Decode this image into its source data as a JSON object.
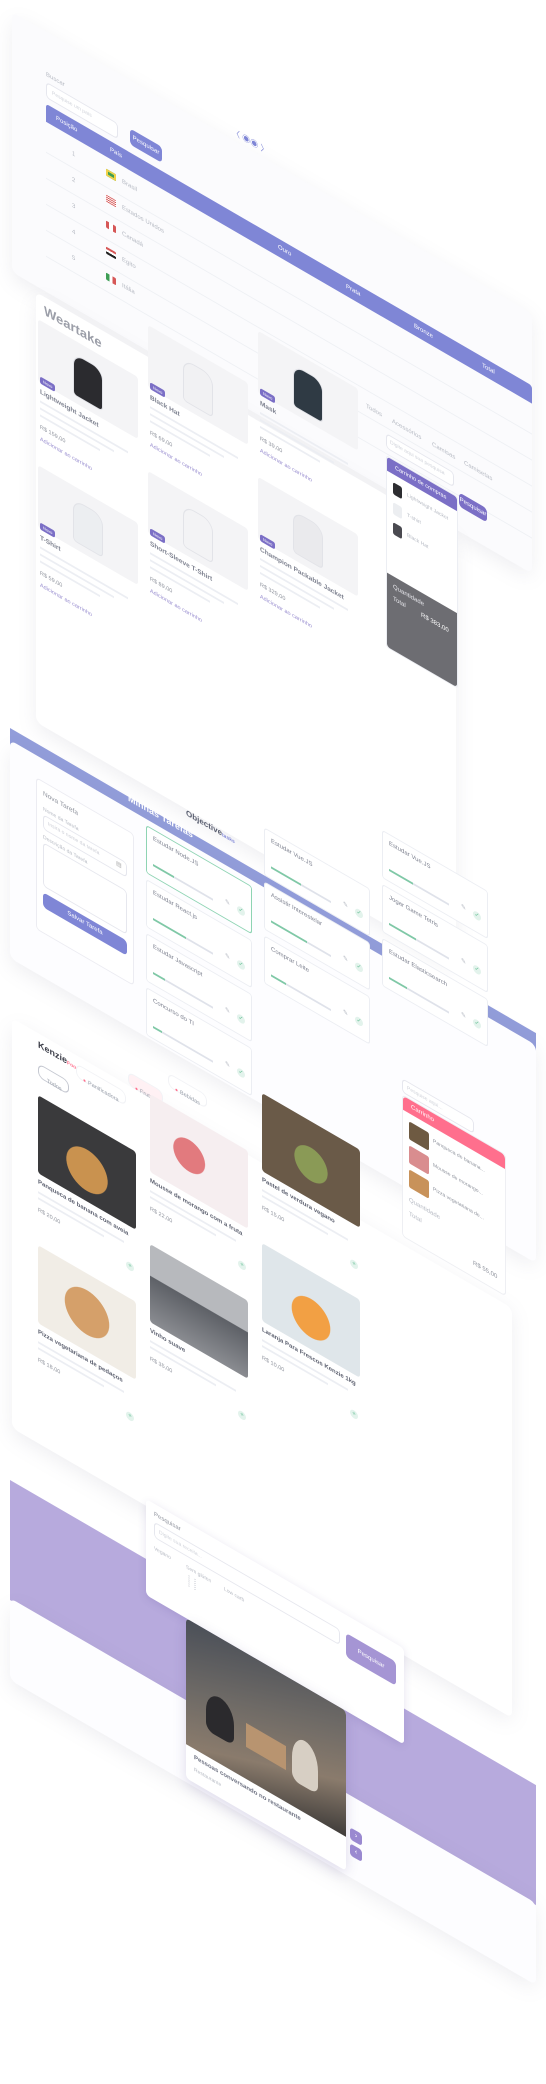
{
  "colors": {
    "primary": "#7f86d6",
    "panel_blue": "#7a87d2",
    "lavender": "#a595d4",
    "purple_badge": "#7b6fc6",
    "cart_pink": "#ff6f8d",
    "progress_green": "#7fc9a6",
    "dark_cart": "#6d6d72"
  },
  "table_app": {
    "search_label": "Buscar",
    "search_placeholder": "Pesquise um país",
    "search_button": "Pesquisar",
    "logo": "〈 ◉◉ 〉",
    "columns": [
      "Posição",
      "País",
      "Ouro",
      "Prata",
      "Bronze",
      "Total"
    ],
    "rows": [
      {
        "pos": "1",
        "country": "Brasil",
        "flag": "brazil-flag-icon"
      },
      {
        "pos": "2",
        "country": "Estados Unidos",
        "flag": "usa-flag-icon"
      },
      {
        "pos": "3",
        "country": "Canadá",
        "flag": "canada-flag-icon"
      },
      {
        "pos": "4",
        "country": "Egito",
        "flag": "egypt-flag-icon"
      },
      {
        "pos": "5",
        "country": "Itália",
        "flag": "italy-flag-icon"
      }
    ]
  },
  "store": {
    "brand": "Weartake",
    "nav": [
      "Todos",
      "Acessórios",
      "Camisas",
      "Camisetas"
    ],
    "search_placeholder": "Digite aqui sua pesquisa",
    "search_button": "Pesquisar",
    "add_label": "Adicionar ao carrinho",
    "products": [
      {
        "name": "Lightweight Jacket",
        "price": "R$ 159,00",
        "badge": "Novo"
      },
      {
        "name": "Black Hat",
        "price": "R$ 69,00",
        "badge": "Novo"
      },
      {
        "name": "Mask",
        "price": "R$ 39,00",
        "badge": "Novo"
      },
      {
        "name": "T-Shirt",
        "price": "R$ 59,00",
        "badge": "Novo"
      },
      {
        "name": "Short-Sleeve T-Shirt",
        "price": "R$ 89,00",
        "badge": "Novo"
      },
      {
        "name": "Champion Packable Jacket",
        "price": "R$ 329,00",
        "badge": "Novo"
      }
    ],
    "cart": {
      "title": "Carrinho de compras",
      "items": [
        "Lightweight Jacket",
        "T-shirt",
        "Black Hat"
      ],
      "quantity_label": "Quantidade",
      "total_label": "Total",
      "total_value": "R$ 383,00"
    }
  },
  "tasks": {
    "new_task_title": "Nova Tarefa",
    "name_label": "Nome da Tarefa",
    "name_placeholder": "Insira o nome da tarefa",
    "desc_label": "Descrição da Tarefa",
    "save_button": "Salvar Tarefa",
    "brand": "Objective",
    "brand_suffix": "tasks",
    "list_title": "Minhas Tarefas",
    "items": [
      {
        "name": "Estudar Node.JS",
        "progress": 0.35
      },
      {
        "name": "Estudar React.js",
        "progress": 0.55
      },
      {
        "name": "Estudar Vue.JS",
        "progress": 0.5
      },
      {
        "name": "Estudar Javascript",
        "progress": 0.2
      },
      {
        "name": "Concurso do TI",
        "progress": 0.15
      },
      {
        "name": "Assistir Interestelar",
        "progress": 0.6
      },
      {
        "name": "Estudar Vue.JS",
        "progress": 0.4
      },
      {
        "name": "Comprar Leite",
        "progress": 0.25
      },
      {
        "name": "Jogar Game Tetris",
        "progress": 0.45
      },
      {
        "name": "Estudar Elasticsearch",
        "progress": 0.3
      }
    ]
  },
  "food": {
    "brand": "Kenzie",
    "brand_suffix": "Food",
    "filters": [
      "Todos",
      "Panificadora",
      "Frutas",
      "Bebidas"
    ],
    "search_placeholder": "Pesquise aqui...",
    "products": [
      {
        "name": "Panqueca de banana com aveia",
        "price": "R$ 20,00"
      },
      {
        "name": "Mousse de morango com a fruta",
        "price": "R$ 22,00"
      },
      {
        "name": "Pastel de verdura vegano",
        "price": "R$ 15,00"
      },
      {
        "name": "Pizza vegetariana de pedaços",
        "price": "R$ 18,00"
      },
      {
        "name": "Vinho suave",
        "price": "R$ 35,00"
      },
      {
        "name": "Laranja Para Frescos Kenzie 1kg",
        "price": "R$ 10,00"
      }
    ],
    "cart": {
      "title": "Carrinho",
      "items": [
        "Panqueca de banana...",
        "Mousse de morango...",
        "Pizza vegetariana de..."
      ],
      "quantity_label": "Quantidade",
      "total_label": "Total",
      "total_value": "R$ 55,00"
    }
  },
  "recipes": {
    "search_label": "Pesquisar",
    "search_placeholder": "Digite sua receita...",
    "chips": [
      "Vegano",
      "Sem glúten",
      "Low carb"
    ],
    "search_button": "Pesquisar",
    "card_title": "Pessoas conversando no restaurante",
    "card_subtitle": "Restaurante"
  }
}
